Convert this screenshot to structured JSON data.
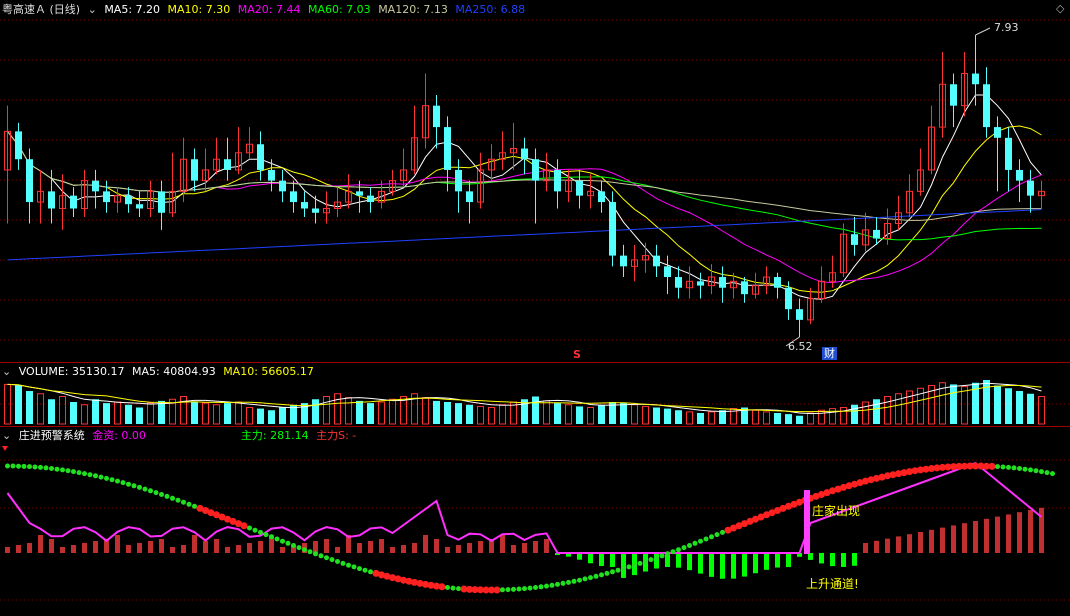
{
  "main_header": {
    "stock_name": "粤高速Ａ (日线)",
    "ma5": "MA5: 7.20",
    "ma10": "MA10: 7.30",
    "ma20": "MA20: 7.44",
    "ma60": "MA60: 7.03",
    "ma120": "MA120: 7.13",
    "ma250": "MA250: 6.88"
  },
  "price_labels": {
    "high": "7.93",
    "low": "6.52",
    "s_marker": "S",
    "fin_marker": "财"
  },
  "volume_header": {
    "label": "VOLUME: 35130.17",
    "ma5": "MA5: 40804.93",
    "ma10": "MA10: 56605.17"
  },
  "indicator_header": {
    "name": "庄进预警系统",
    "fund": "金资: 0.00",
    "main_force": "主力: 281.14",
    "main_force_s": "主力S: -"
  },
  "indicator_labels": {
    "dealer_appear": "庄家出现",
    "uptrend": "上升通道!"
  },
  "colors": {
    "up": "#ff3232",
    "down": "#54ffff",
    "ma5": "#ffffff",
    "ma10": "#ffff00",
    "ma20": "#ff00ff",
    "ma60": "#00ff00",
    "ma120": "#c8c8a0",
    "ma250": "#2040ff",
    "separator": "#a00000"
  },
  "chart_data": {
    "type": "candlestick",
    "price_high": 7.93,
    "price_low": 6.52,
    "candles": [
      [
        7.3,
        7.48,
        7.6,
        7.05
      ],
      [
        7.48,
        7.35,
        7.52,
        7.3
      ],
      [
        7.35,
        7.15,
        7.4,
        7.05
      ],
      [
        7.15,
        7.2,
        7.3,
        7.05
      ],
      [
        7.2,
        7.12,
        7.3,
        7.05
      ],
      [
        7.12,
        7.18,
        7.28,
        7.02
      ],
      [
        7.18,
        7.12,
        7.22,
        7.08
      ],
      [
        7.12,
        7.25,
        7.3,
        7.08
      ],
      [
        7.25,
        7.2,
        7.3,
        7.12
      ],
      [
        7.2,
        7.15,
        7.25,
        7.1
      ],
      [
        7.15,
        7.18,
        7.22,
        7.1
      ],
      [
        7.18,
        7.14,
        7.22,
        7.1
      ],
      [
        7.14,
        7.12,
        7.2,
        7.08
      ],
      [
        7.12,
        7.2,
        7.25,
        7.08
      ],
      [
        7.2,
        7.1,
        7.25,
        7.02
      ],
      [
        7.1,
        7.2,
        7.38,
        7.08
      ],
      [
        7.2,
        7.35,
        7.45,
        7.15
      ],
      [
        7.35,
        7.25,
        7.4,
        7.2
      ],
      [
        7.25,
        7.3,
        7.4,
        7.2
      ],
      [
        7.3,
        7.35,
        7.45,
        7.28
      ],
      [
        7.35,
        7.3,
        7.45,
        7.25
      ],
      [
        7.3,
        7.38,
        7.5,
        7.28
      ],
      [
        7.38,
        7.42,
        7.5,
        7.35
      ],
      [
        7.42,
        7.3,
        7.48,
        7.25
      ],
      [
        7.3,
        7.25,
        7.35,
        7.2
      ],
      [
        7.25,
        7.2,
        7.3,
        7.15
      ],
      [
        7.2,
        7.15,
        7.25,
        7.1
      ],
      [
        7.15,
        7.12,
        7.2,
        7.08
      ],
      [
        7.12,
        7.1,
        7.18,
        7.05
      ],
      [
        7.1,
        7.12,
        7.2,
        7.05
      ],
      [
        7.12,
        7.15,
        7.22,
        7.08
      ],
      [
        7.15,
        7.2,
        7.28,
        7.12
      ],
      [
        7.2,
        7.18,
        7.25,
        7.1
      ],
      [
        7.18,
        7.15,
        7.22,
        7.1
      ],
      [
        7.15,
        7.2,
        7.25,
        7.12
      ],
      [
        7.2,
        7.25,
        7.3,
        7.18
      ],
      [
        7.25,
        7.3,
        7.4,
        7.22
      ],
      [
        7.3,
        7.45,
        7.6,
        7.28
      ],
      [
        7.45,
        7.6,
        7.75,
        7.4
      ],
      [
        7.6,
        7.5,
        7.65,
        7.4
      ],
      [
        7.5,
        7.3,
        7.55,
        7.2
      ],
      [
        7.3,
        7.2,
        7.35,
        7.1
      ],
      [
        7.2,
        7.15,
        7.25,
        7.05
      ],
      [
        7.15,
        7.3,
        7.38,
        7.12
      ],
      [
        7.3,
        7.35,
        7.42,
        7.25
      ],
      [
        7.35,
        7.38,
        7.48,
        7.3
      ],
      [
        7.38,
        7.4,
        7.52,
        7.3
      ],
      [
        7.4,
        7.35,
        7.45,
        7.28
      ],
      [
        7.35,
        7.25,
        7.4,
        7.05
      ],
      [
        7.25,
        7.3,
        7.38,
        7.2
      ],
      [
        7.3,
        7.2,
        7.35,
        7.12
      ],
      [
        7.2,
        7.25,
        7.3,
        7.15
      ],
      [
        7.25,
        7.18,
        7.3,
        7.12
      ],
      [
        7.18,
        7.2,
        7.28,
        7.12
      ],
      [
        7.2,
        7.15,
        7.25,
        7.1
      ],
      [
        7.15,
        6.9,
        7.2,
        6.85
      ],
      [
        6.9,
        6.85,
        6.95,
        6.8
      ],
      [
        6.85,
        6.88,
        6.95,
        6.78
      ],
      [
        6.88,
        6.9,
        6.96,
        6.82
      ],
      [
        6.9,
        6.85,
        6.95,
        6.8
      ],
      [
        6.85,
        6.8,
        6.9,
        6.72
      ],
      [
        6.8,
        6.75,
        6.85,
        6.7
      ],
      [
        6.75,
        6.78,
        6.85,
        6.7
      ],
      [
        6.78,
        6.76,
        6.82,
        6.7
      ],
      [
        6.76,
        6.8,
        6.86,
        6.72
      ],
      [
        6.8,
        6.75,
        6.85,
        6.68
      ],
      [
        6.75,
        6.78,
        6.82,
        6.7
      ],
      [
        6.78,
        6.72,
        6.8,
        6.68
      ],
      [
        6.72,
        6.76,
        6.82,
        6.7
      ],
      [
        6.76,
        6.8,
        6.85,
        6.72
      ],
      [
        6.8,
        6.75,
        6.82,
        6.7
      ],
      [
        6.75,
        6.65,
        6.78,
        6.6
      ],
      [
        6.65,
        6.6,
        6.7,
        6.52
      ],
      [
        6.6,
        6.7,
        6.75,
        6.58
      ],
      [
        6.7,
        6.78,
        6.85,
        6.68
      ],
      [
        6.78,
        6.82,
        6.9,
        6.75
      ],
      [
        6.82,
        7.0,
        7.05,
        6.8
      ],
      [
        7.0,
        6.95,
        7.08,
        6.9
      ],
      [
        6.95,
        7.02,
        7.1,
        6.92
      ],
      [
        7.02,
        6.98,
        7.08,
        6.95
      ],
      [
        6.98,
        7.05,
        7.12,
        6.95
      ],
      [
        7.05,
        7.1,
        7.18,
        7.02
      ],
      [
        7.1,
        7.2,
        7.28,
        7.08
      ],
      [
        7.2,
        7.3,
        7.4,
        7.18
      ],
      [
        7.3,
        7.5,
        7.6,
        7.28
      ],
      [
        7.5,
        7.7,
        7.85,
        7.45
      ],
      [
        7.7,
        7.6,
        7.75,
        7.5
      ],
      [
        7.6,
        7.75,
        7.85,
        7.55
      ],
      [
        7.75,
        7.7,
        7.93,
        7.6
      ],
      [
        7.7,
        7.5,
        7.78,
        7.45
      ],
      [
        7.5,
        7.45,
        7.55,
        7.2
      ],
      [
        7.45,
        7.3,
        7.5,
        7.2
      ],
      [
        7.3,
        7.25,
        7.35,
        7.15
      ],
      [
        7.25,
        7.18,
        7.3,
        7.1
      ],
      [
        7.18,
        7.2,
        7.25,
        7.12
      ]
    ],
    "volumes": [
      72,
      70,
      60,
      55,
      45,
      50,
      40,
      35,
      45,
      38,
      40,
      35,
      30,
      38,
      42,
      45,
      50,
      40,
      38,
      35,
      38,
      40,
      30,
      28,
      25,
      30,
      35,
      38,
      45,
      50,
      55,
      48,
      42,
      38,
      40,
      45,
      50,
      55,
      48,
      42,
      40,
      38,
      35,
      32,
      30,
      35,
      40,
      45,
      50,
      42,
      38,
      35,
      32,
      30,
      35,
      40,
      38,
      35,
      32,
      30,
      28,
      25,
      22,
      20,
      22,
      25,
      28,
      30,
      25,
      22,
      20,
      18,
      15,
      20,
      25,
      28,
      30,
      35,
      40,
      45,
      50,
      55,
      60,
      65,
      70,
      75,
      72,
      68,
      75,
      80,
      70,
      65,
      60,
      55,
      50
    ],
    "indicator": {
      "fund": 0.0,
      "main_force": 281.14
    }
  }
}
